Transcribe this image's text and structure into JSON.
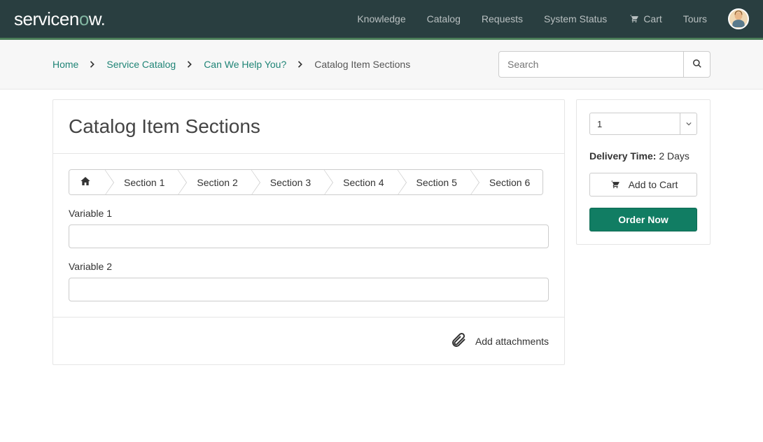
{
  "brand": {
    "name": "servicenow"
  },
  "nav": {
    "knowledge": "Knowledge",
    "catalog": "Catalog",
    "requests": "Requests",
    "system_status": "System Status",
    "cart": "Cart",
    "tours": "Tours"
  },
  "breadcrumb": {
    "home": "Home",
    "service_catalog": "Service Catalog",
    "help": "Can We Help You?",
    "current": "Catalog Item Sections"
  },
  "search": {
    "placeholder": "Search"
  },
  "page": {
    "title": "Catalog Item Sections",
    "tabs": [
      "Section 1",
      "Section 2",
      "Section 3",
      "Section 4",
      "Section 5",
      "Section 6"
    ],
    "fields": [
      {
        "label": "Variable 1",
        "value": ""
      },
      {
        "label": "Variable 2",
        "value": ""
      }
    ],
    "attach_label": "Add attachments"
  },
  "sidebar": {
    "quantity": "1",
    "delivery_label": "Delivery Time:",
    "delivery_value": "2 Days",
    "add_to_cart": "Add to Cart",
    "order_now": "Order Now"
  }
}
